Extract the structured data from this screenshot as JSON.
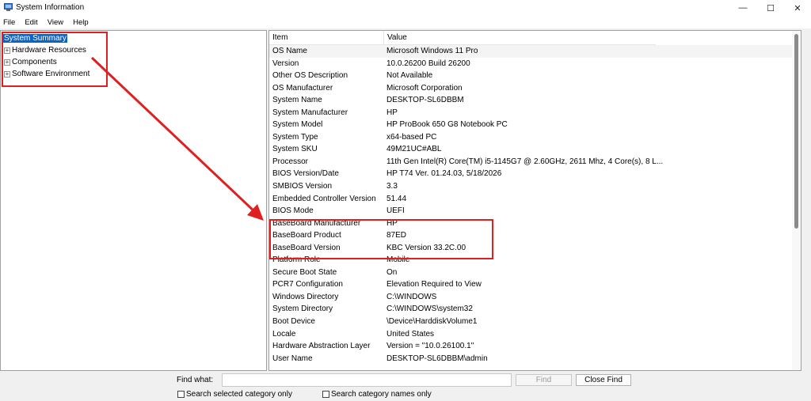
{
  "window": {
    "title": "System Information",
    "controls": {
      "minimize": "—",
      "maximize": "☐",
      "close": "✕"
    }
  },
  "menu": [
    "File",
    "Edit",
    "View",
    "Help"
  ],
  "tree": {
    "items": [
      {
        "label": "System Summary",
        "selected": true,
        "expandable": false
      },
      {
        "label": "Hardware Resources",
        "expander": "+"
      },
      {
        "label": "Components",
        "expander": "+"
      },
      {
        "label": "Software Environment",
        "expander": "+"
      }
    ]
  },
  "list": {
    "headers": {
      "item": "Item",
      "value": "Value"
    },
    "rows": [
      {
        "item": "OS Name",
        "value": "Microsoft Windows 11 Pro"
      },
      {
        "item": "Version",
        "value": "10.0.26200 Build 26200"
      },
      {
        "item": "Other OS Description",
        "value": "Not Available"
      },
      {
        "item": "OS Manufacturer",
        "value": "Microsoft Corporation"
      },
      {
        "item": "System Name",
        "value": "DESKTOP-SL6DBBM"
      },
      {
        "item": "System Manufacturer",
        "value": "HP"
      },
      {
        "item": "System Model",
        "value": "HP ProBook 650 G8 Notebook PC"
      },
      {
        "item": "System Type",
        "value": "x64-based PC"
      },
      {
        "item": "System SKU",
        "value": "49M21UC#ABL"
      },
      {
        "item": "Processor",
        "value": "11th Gen Intel(R) Core(TM) i5-1145G7 @ 2.60GHz, 2611 Mhz, 4 Core(s), 8 L..."
      },
      {
        "item": "BIOS Version/Date",
        "value": "HP T74 Ver. 01.24.03, 5/18/2026"
      },
      {
        "item": "SMBIOS Version",
        "value": "3.3"
      },
      {
        "item": "Embedded Controller Version",
        "value": "51.44"
      },
      {
        "item": "BIOS Mode",
        "value": "UEFI"
      },
      {
        "item": "BaseBoard Manufacturer",
        "value": "HP"
      },
      {
        "item": "BaseBoard Product",
        "value": "87ED"
      },
      {
        "item": "BaseBoard Version",
        "value": "KBC Version 33.2C.00"
      },
      {
        "item": "Platform Role",
        "value": "Mobile"
      },
      {
        "item": "Secure Boot State",
        "value": "On"
      },
      {
        "item": "PCR7 Configuration",
        "value": "Elevation Required to View"
      },
      {
        "item": "Windows Directory",
        "value": "C:\\WINDOWS"
      },
      {
        "item": "System Directory",
        "value": "C:\\WINDOWS\\system32"
      },
      {
        "item": "Boot Device",
        "value": "\\Device\\HarddiskVolume1"
      },
      {
        "item": "Locale",
        "value": "United States"
      },
      {
        "item": "Hardware Abstraction Layer",
        "value": "Version = \"10.0.26100.1\""
      },
      {
        "item": "User Name",
        "value": "DESKTOP-SL6DBBM\\admin"
      }
    ]
  },
  "find": {
    "label": "Find what:",
    "value": "",
    "find_button": "Find",
    "close_button": "Close Find",
    "checkbox_selected": "Search selected category only",
    "checkbox_names": "Search category names only"
  },
  "colors": {
    "selection": "#0a64c8",
    "annotation": "#e02020"
  }
}
